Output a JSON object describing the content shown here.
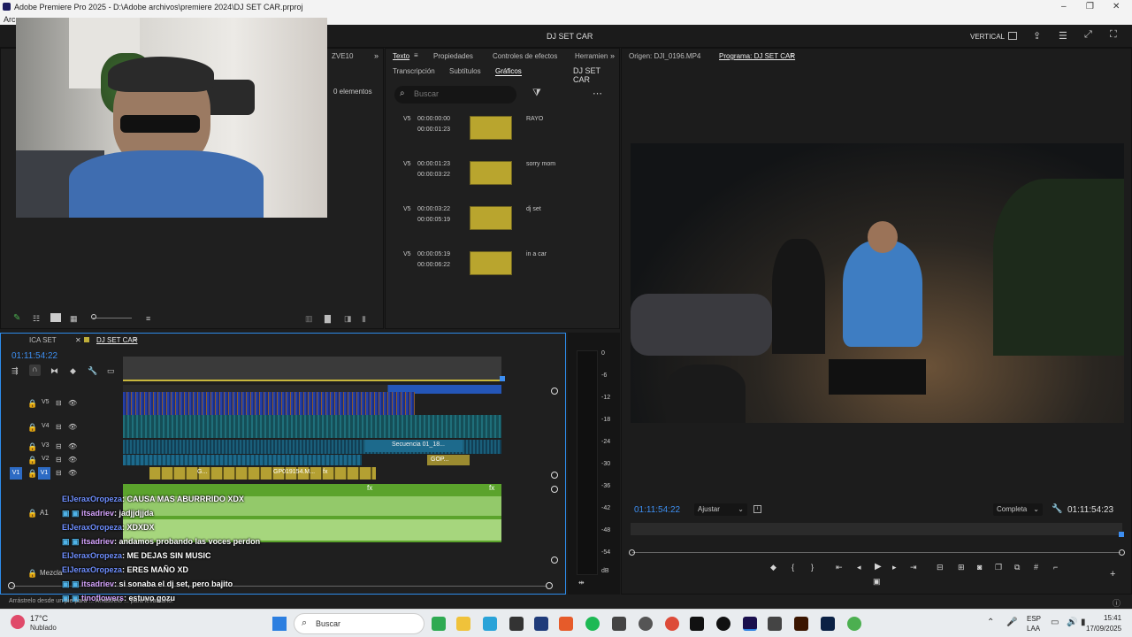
{
  "window": {
    "title": "Adobe Premiere Pro 2025 - D:\\Adobe archivos\\premiere 2024\\DJ SET CAR.prproj",
    "minimize": "–",
    "maximize": "❐",
    "close": "✕"
  },
  "menubar": {
    "items": [
      "Arc"
    ]
  },
  "header": {
    "project": "DJ SET CAR",
    "workspace": "VERTICAL"
  },
  "project_panel": {
    "tab": "ZVE10",
    "count": "0 elementos"
  },
  "text_panel": {
    "tabs": [
      "Texto",
      "Propiedades",
      "Controles de efectos",
      "Herramien"
    ],
    "subtabs": [
      "Transcripción",
      "Subtítulos",
      "Gráficos"
    ],
    "sequence": "DJ SET CAR",
    "search_placeholder": "Buscar",
    "items": [
      {
        "track": "V5",
        "in": "00:00:00:00",
        "out": "00:00:01:23",
        "label": "RAYO"
      },
      {
        "track": "V5",
        "in": "00:00:01:23",
        "out": "00:00:03:22",
        "label": "sorry mom"
      },
      {
        "track": "V5",
        "in": "00:00:03:22",
        "out": "00:00:05:19",
        "label": "dj set"
      },
      {
        "track": "V5",
        "in": "00:00:05:19",
        "out": "00:00:06:22",
        "label": "in a car"
      }
    ]
  },
  "monitor": {
    "source_tab": "Origen: DJI_0196.MP4",
    "program_tab": "Programa: DJ SET CAR",
    "timecode_left": "01:11:54:22",
    "fit": "Ajustar",
    "quality": "Completa",
    "timecode_right": "01:11:54:23"
  },
  "timeline": {
    "tabs": [
      "ICA SET",
      "DJ SET CAR"
    ],
    "timecode": "01:11:54:22",
    "tracks": [
      "V5",
      "V4",
      "V3",
      "V2",
      "V1"
    ],
    "audio_tracks": [
      "A1"
    ],
    "mix_label": "Mezcla",
    "clip_labels": [
      "Secuencia 01_18...",
      "GOP...",
      "G...",
      "GP019154.M...",
      "fx",
      "fx",
      "fx"
    ],
    "vu_scale": [
      "0",
      "-6",
      "-12",
      "-18",
      "-24",
      "-30",
      "-36",
      "-42",
      "-48",
      "-54",
      "dB"
    ]
  },
  "chat": [
    {
      "user": "ElJeraxOropeza",
      "msg": ": CAUSA MAS ABURRRIDO XDX"
    },
    {
      "user": "itsadriev",
      "msg": ": jadjjdjjda"
    },
    {
      "user": "ElJeraxOropeza",
      "msg": ": XDXDX"
    },
    {
      "user": "itsadriev",
      "msg": ": andamos probando las voces perdon"
    },
    {
      "user": "ElJeraxOropeza",
      "msg": ": ME DEJAS SIN MUSIC"
    },
    {
      "user": "ElJeraxOropeza",
      "msg": ": ERES MAÑO XD"
    },
    {
      "user": "itsadriev",
      "msg": ": si sonaba el dj set, pero bajito"
    },
    {
      "user": "tinoflowers",
      "msg": ": estuvo gozu"
    }
  ],
  "status_hint": "Arrástrelo desde un pie para ... Arrástrelo ... para levantarlo.",
  "taskbar": {
    "weather_temp": "17°C",
    "weather_desc": "Nublado",
    "search": "Buscar",
    "lang1": "ESP",
    "lang2": "LAA",
    "time": "15:41",
    "date": "17/09/2025"
  },
  "colors": {
    "accent_blue": "#2d8ceb",
    "clip_yellow": "#b9a52e",
    "audio_green": "#8bc34a"
  }
}
